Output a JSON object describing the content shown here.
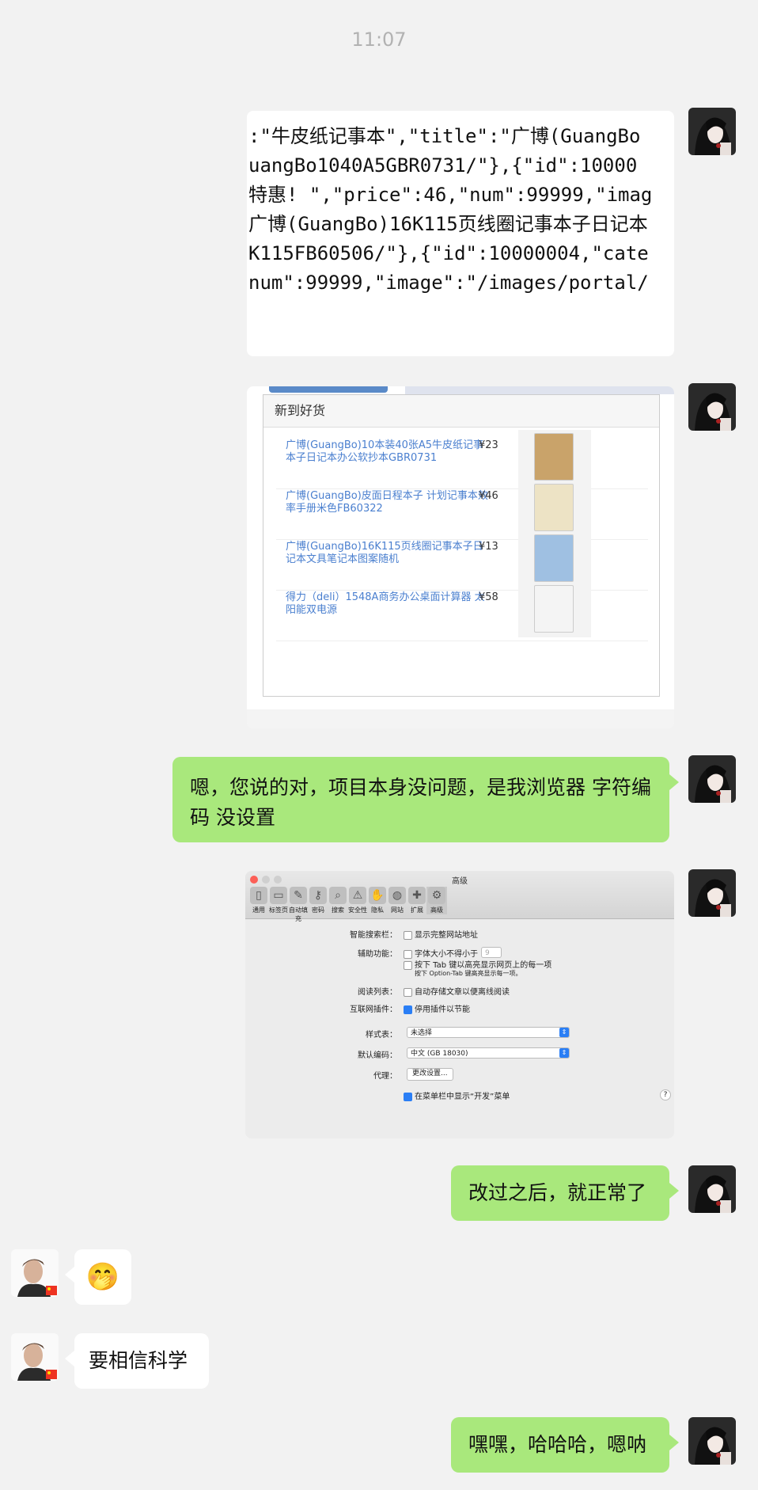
{
  "time": "11:07",
  "code_lines": [
    ":\"牛皮纸记事本\",\"title\":\"广博(GuangBo",
    "uangBo1040A5GBR0731/\"},{\"id\":10000",
    "特惠! \",\"price\":46,\"num\":99999,\"imag",
    "广博(GuangBo)16K115页线圈记事本子日记本",
    "K115FB60506/\"},{\"id\":10000004,\"cate",
    "num\":99999,\"image\":\"/images/portal/"
  ],
  "products": {
    "title": "新到好货",
    "items": [
      {
        "name": "广博(GuangBo)10本装40张A5牛皮纸记事本子日记本办公软抄本GBR0731",
        "price": "¥23",
        "thumb": "kraft"
      },
      {
        "name": "广博(GuangBo)皮面日程本子 计划记事本效率手册米色FB60322",
        "price": "¥46",
        "thumb": "beige"
      },
      {
        "name": "广博(GuangBo)16K115页线圈记事本子日记本文具笔记本图案随机",
        "price": "¥13",
        "thumb": "spiral"
      },
      {
        "name": "得力（deli）1548A商务办公桌面计算器 太阳能双电源",
        "price": "¥58",
        "thumb": "calculator"
      }
    ]
  },
  "msg1": "嗯，您说的对，项目本身没问题，是我浏览器 字符编码 没设置",
  "settings": {
    "window_title": "高级",
    "toolbar": [
      "通用",
      "标签页",
      "自动填充",
      "密码",
      "搜索",
      "安全性",
      "隐私",
      "网站",
      "扩展",
      "高级"
    ],
    "smart_search_label": "智能搜索栏：",
    "smart_search_opt": "显示完整网站地址",
    "access_label": "辅助功能：",
    "access_opt1": "字体大小不得小于",
    "access_size": "9",
    "access_opt2": "按下 Tab 键以高亮显示网页上的每一项",
    "access_note": "按下 Option-Tab 键高亮显示每一项。",
    "reading_label": "阅读列表：",
    "reading_opt": "自动存储文章以便离线阅读",
    "plugins_label": "互联网插件：",
    "plugins_opt": "停用插件以节能",
    "style_label": "样式表：",
    "style_value": "未选择",
    "enc_label": "默认编码：",
    "enc_value": "中文 (GB 18030)",
    "proxy_label": "代理：",
    "proxy_btn": "更改设置...",
    "dev_opt": "在菜单栏中显示“开发”菜单",
    "help": "?"
  },
  "msg2": "改过之后，就正常了",
  "emoji": "🤭",
  "msg3": "要相信科学",
  "msg4": "嘿嘿，哈哈哈，嗯呐",
  "colors": {
    "bubble_me": "#a9e87c",
    "bubble_other": "#ffffff",
    "background": "#f2f2f2"
  }
}
